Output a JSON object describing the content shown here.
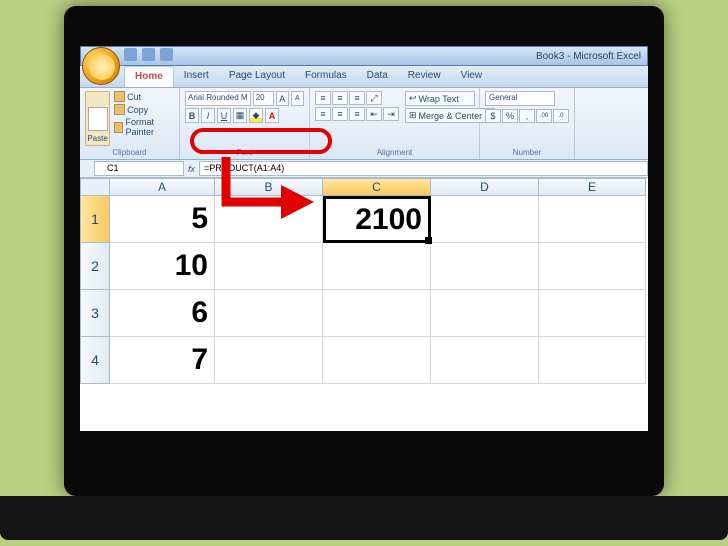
{
  "title": "Book3 - Microsoft Excel",
  "tabs": [
    "Home",
    "Insert",
    "Page Layout",
    "Formulas",
    "Data",
    "Review",
    "View"
  ],
  "activeTab": 0,
  "ribbon": {
    "clipboard": {
      "label": "Clipboard",
      "paste": "Paste",
      "cut": "Cut",
      "copy": "Copy",
      "fp": "Format Painter"
    },
    "font": {
      "label": "Font",
      "name": "Arial Rounded M",
      "size": "20"
    },
    "alignment": {
      "label": "Alignment",
      "wrap": "Wrap Text",
      "merge": "Merge & Center"
    },
    "number": {
      "label": "Number",
      "format": "General"
    }
  },
  "namebox": "C1",
  "formula": "=PRODUCT(A1:A4)",
  "columns": [
    "A",
    "B",
    "C",
    "D",
    "E"
  ],
  "rowNums": [
    "1",
    "2",
    "3",
    "4"
  ],
  "cells": {
    "A1": "5",
    "A2": "10",
    "A3": "6",
    "A4": "7",
    "C1": "2100"
  },
  "selected": {
    "row": 0,
    "col": 2
  }
}
